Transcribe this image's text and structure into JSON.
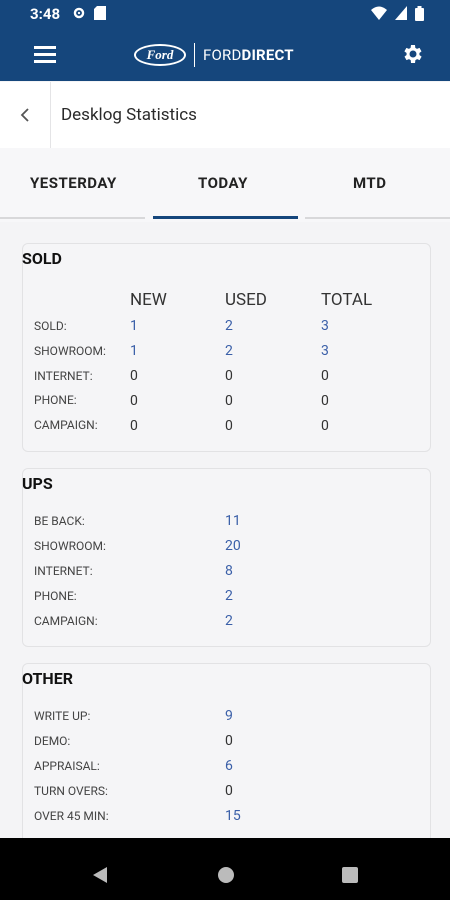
{
  "status": {
    "time": "3:48"
  },
  "appbar": {
    "brand_oval": "Ford",
    "brand_text_light": "FORD",
    "brand_text_bold": "DIRECT"
  },
  "title": "Desklog Statistics",
  "tabs": {
    "yesterday": "YESTERDAY",
    "today": "TODAY",
    "mtd": "MTD",
    "active": "TODAY"
  },
  "colors": {
    "header": "#15467c",
    "value_blue": "#3a5fa8"
  },
  "sold": {
    "title": "SOLD",
    "headers": {
      "new": "NEW",
      "used": "USED",
      "total": "TOTAL"
    },
    "rows": [
      {
        "label": "SOLD:",
        "new": "1",
        "used": "2",
        "total": "3"
      },
      {
        "label": "SHOWROOM:",
        "new": "1",
        "used": "2",
        "total": "3"
      },
      {
        "label": "INTERNET:",
        "new": "0",
        "used": "0",
        "total": "0"
      },
      {
        "label": "PHONE:",
        "new": "0",
        "used": "0",
        "total": "0"
      },
      {
        "label": "CAMPAIGN:",
        "new": "0",
        "used": "0",
        "total": "0"
      }
    ]
  },
  "ups": {
    "title": "UPS",
    "rows": [
      {
        "label": "BE BACK:",
        "value": "11"
      },
      {
        "label": "SHOWROOM:",
        "value": "20"
      },
      {
        "label": "INTERNET:",
        "value": "8"
      },
      {
        "label": "PHONE:",
        "value": "2"
      },
      {
        "label": "CAMPAIGN:",
        "value": "2"
      }
    ]
  },
  "other": {
    "title": "OTHER",
    "rows": [
      {
        "label": "WRITE UP:",
        "value": "9"
      },
      {
        "label": "DEMO:",
        "value": "0"
      },
      {
        "label": "APPRAISAL:",
        "value": "6"
      },
      {
        "label": "TURN OVERS:",
        "value": "0"
      },
      {
        "label": "OVER 45 MIN:",
        "value": "15"
      }
    ]
  }
}
